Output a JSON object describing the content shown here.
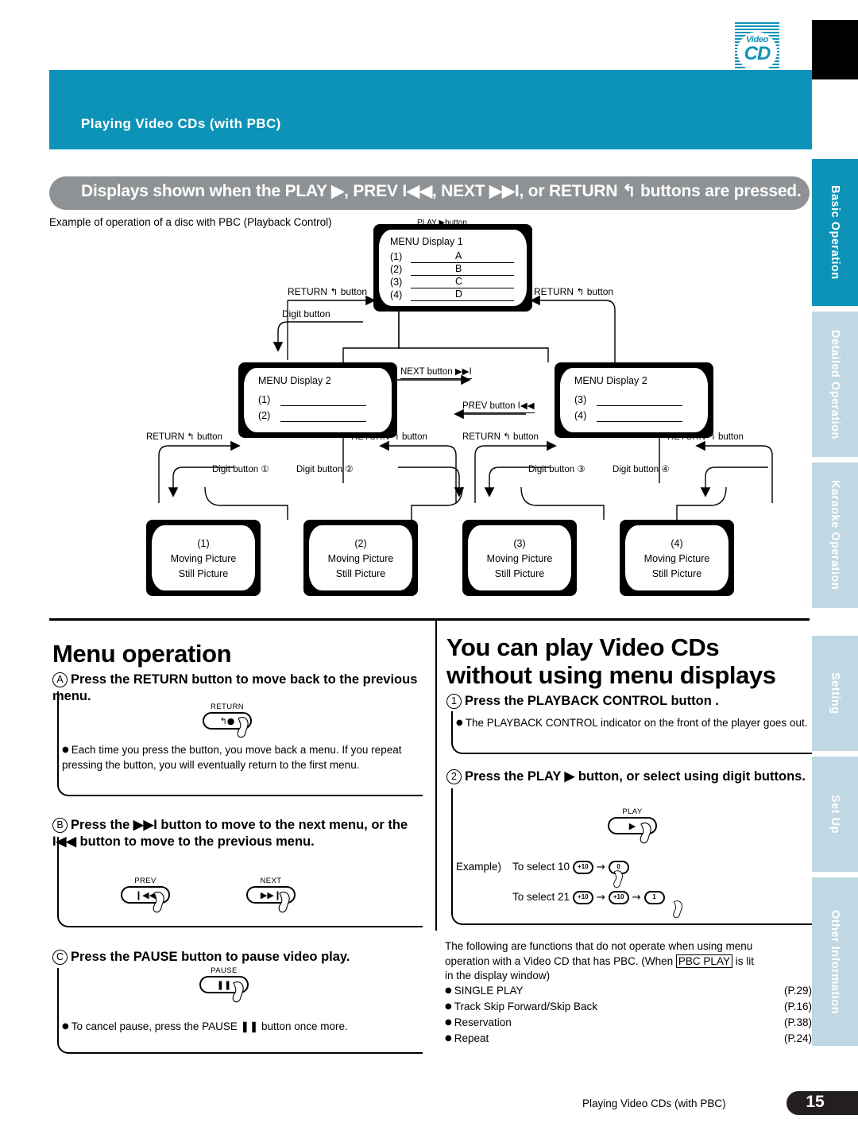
{
  "logo": {
    "line1": "Video",
    "line2": "CD",
    "name": "video-cd-logo"
  },
  "header": {
    "title": "Playing Video CDs (with PBC)"
  },
  "banner": {
    "text": "Displays shown when the PLAY ▶, PREV I◀◀, NEXT ▶▶I, or RETURN ↰ buttons are pressed."
  },
  "intro": "Example of operation of a disc with PBC (Playback Control)",
  "diagram": {
    "play_button_label": "PLAY ▶button",
    "next_button_label": "NEXT button ▶▶I",
    "prev_button_label": "PREV button I◀◀",
    "return_button_label": "RETURN ↰ button",
    "digit_button_label": "Digit button",
    "digit_button_1": "Digit button ①",
    "digit_button_2": "Digit button ②",
    "digit_button_3": "Digit button ③",
    "digit_button_4": "Digit button ④",
    "menu1": {
      "title": "MENU Display 1",
      "rows": [
        {
          "num": "(1)",
          "val": "A"
        },
        {
          "num": "(2)",
          "val": "B"
        },
        {
          "num": "(3)",
          "val": "C"
        },
        {
          "num": "(4)",
          "val": "D"
        }
      ]
    },
    "menu2_left": {
      "title": "MENU Display 2",
      "rows": [
        {
          "num": "(1)"
        },
        {
          "num": "(2)"
        }
      ]
    },
    "menu2_right": {
      "title": "MENU Display 2",
      "rows": [
        {
          "num": "(3)"
        },
        {
          "num": "(4)"
        }
      ]
    },
    "pictures": [
      {
        "num": "(1)",
        "line1": "Moving Picture",
        "line2": "Still Picture"
      },
      {
        "num": "(2)",
        "line1": "Moving Picture",
        "line2": "Still Picture"
      },
      {
        "num": "(3)",
        "line1": "Moving Picture",
        "line2": "Still Picture"
      },
      {
        "num": "(4)",
        "line1": "Moving Picture",
        "line2": "Still Picture"
      }
    ]
  },
  "left_column": {
    "heading": "Menu operation",
    "step_a": {
      "marker": "A",
      "text": "Press the RETURN button to move back to the previous menu.",
      "button_caption": "RETURN",
      "note": "Each time you press the button, you move back a menu. If you repeat pressing the button, you will eventually return to the first menu."
    },
    "step_b": {
      "marker": "B",
      "text": "Press the ▶▶I button to move to the next menu, or the I◀◀ button to move to the previous menu.",
      "button_prev_caption": "PREV",
      "button_next_caption": "NEXT"
    },
    "step_c": {
      "marker": "C",
      "text": "Press the PAUSE button to pause video play.",
      "button_caption": "PAUSE",
      "note": "To cancel pause, press the PAUSE ❚❚ button once more."
    }
  },
  "right_column": {
    "heading_line1": "You can play Video CDs",
    "heading_line2": "without using menu displays",
    "step_1": {
      "marker": "1",
      "text": "Press the PLAYBACK CONTROL button .",
      "note": "The PLAYBACK CONTROL indicator on the front of the player goes out."
    },
    "step_2": {
      "marker": "2",
      "text": "Press the PLAY ▶ button, or select using digit buttons.",
      "button_caption": "PLAY",
      "example_label": "Example)",
      "example_1": {
        "text": "To select 10",
        "keys": [
          "+10",
          "0"
        ]
      },
      "example_2": {
        "text": "To select 21",
        "keys": [
          "+10",
          "+10",
          "1"
        ]
      }
    },
    "footnote": {
      "line1": "The following are functions that do not operate when using menu",
      "line2_a": "operation with a Video CD that has PBC. (When",
      "boxed": "PBC PLAY",
      "line2_b": "is lit",
      "line3": "in the display window)",
      "items": [
        {
          "label": "SINGLE PLAY",
          "page": "(P.29)"
        },
        {
          "label": "Track Skip Forward/Skip Back",
          "page": "(P.16)"
        },
        {
          "label": "Reservation",
          "page": "(P.38)"
        },
        {
          "label": "Repeat",
          "page": "(P.24)"
        }
      ]
    }
  },
  "side_tabs": [
    {
      "label": "Basic Operation",
      "active": true
    },
    {
      "label": "Detailed Operation",
      "active": false
    },
    {
      "label": "Karaoke Operation",
      "active": false
    },
    {
      "label": "Setting",
      "active": false
    },
    {
      "label": "Set Up",
      "active": false
    },
    {
      "label": "Other Information",
      "active": false
    }
  ],
  "footer": {
    "text": "Playing Video CDs (with PBC)",
    "page": "15"
  },
  "colors": {
    "teal": "#0d93b8",
    "tab_inactive": "#bfd8e3",
    "banner_gray": "#8f9294"
  }
}
